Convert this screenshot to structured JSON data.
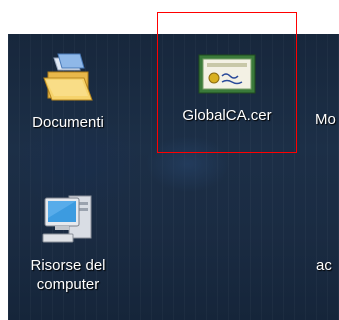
{
  "desktop": {
    "icons": [
      {
        "label": "Documenti",
        "icon": "folder-documents-icon"
      },
      {
        "label": "GlobalCA.cer",
        "icon": "certificate-icon"
      },
      {
        "label": "Mo",
        "icon": ""
      },
      {
        "label": "Risorse del computer",
        "label_line1": "Risorse del",
        "label_line2": "computer",
        "icon": "computer-icon"
      },
      {
        "label": "ac",
        "icon": ""
      }
    ]
  },
  "highlight": {
    "color": "#ff0000",
    "target": "GlobalCA.cer"
  }
}
